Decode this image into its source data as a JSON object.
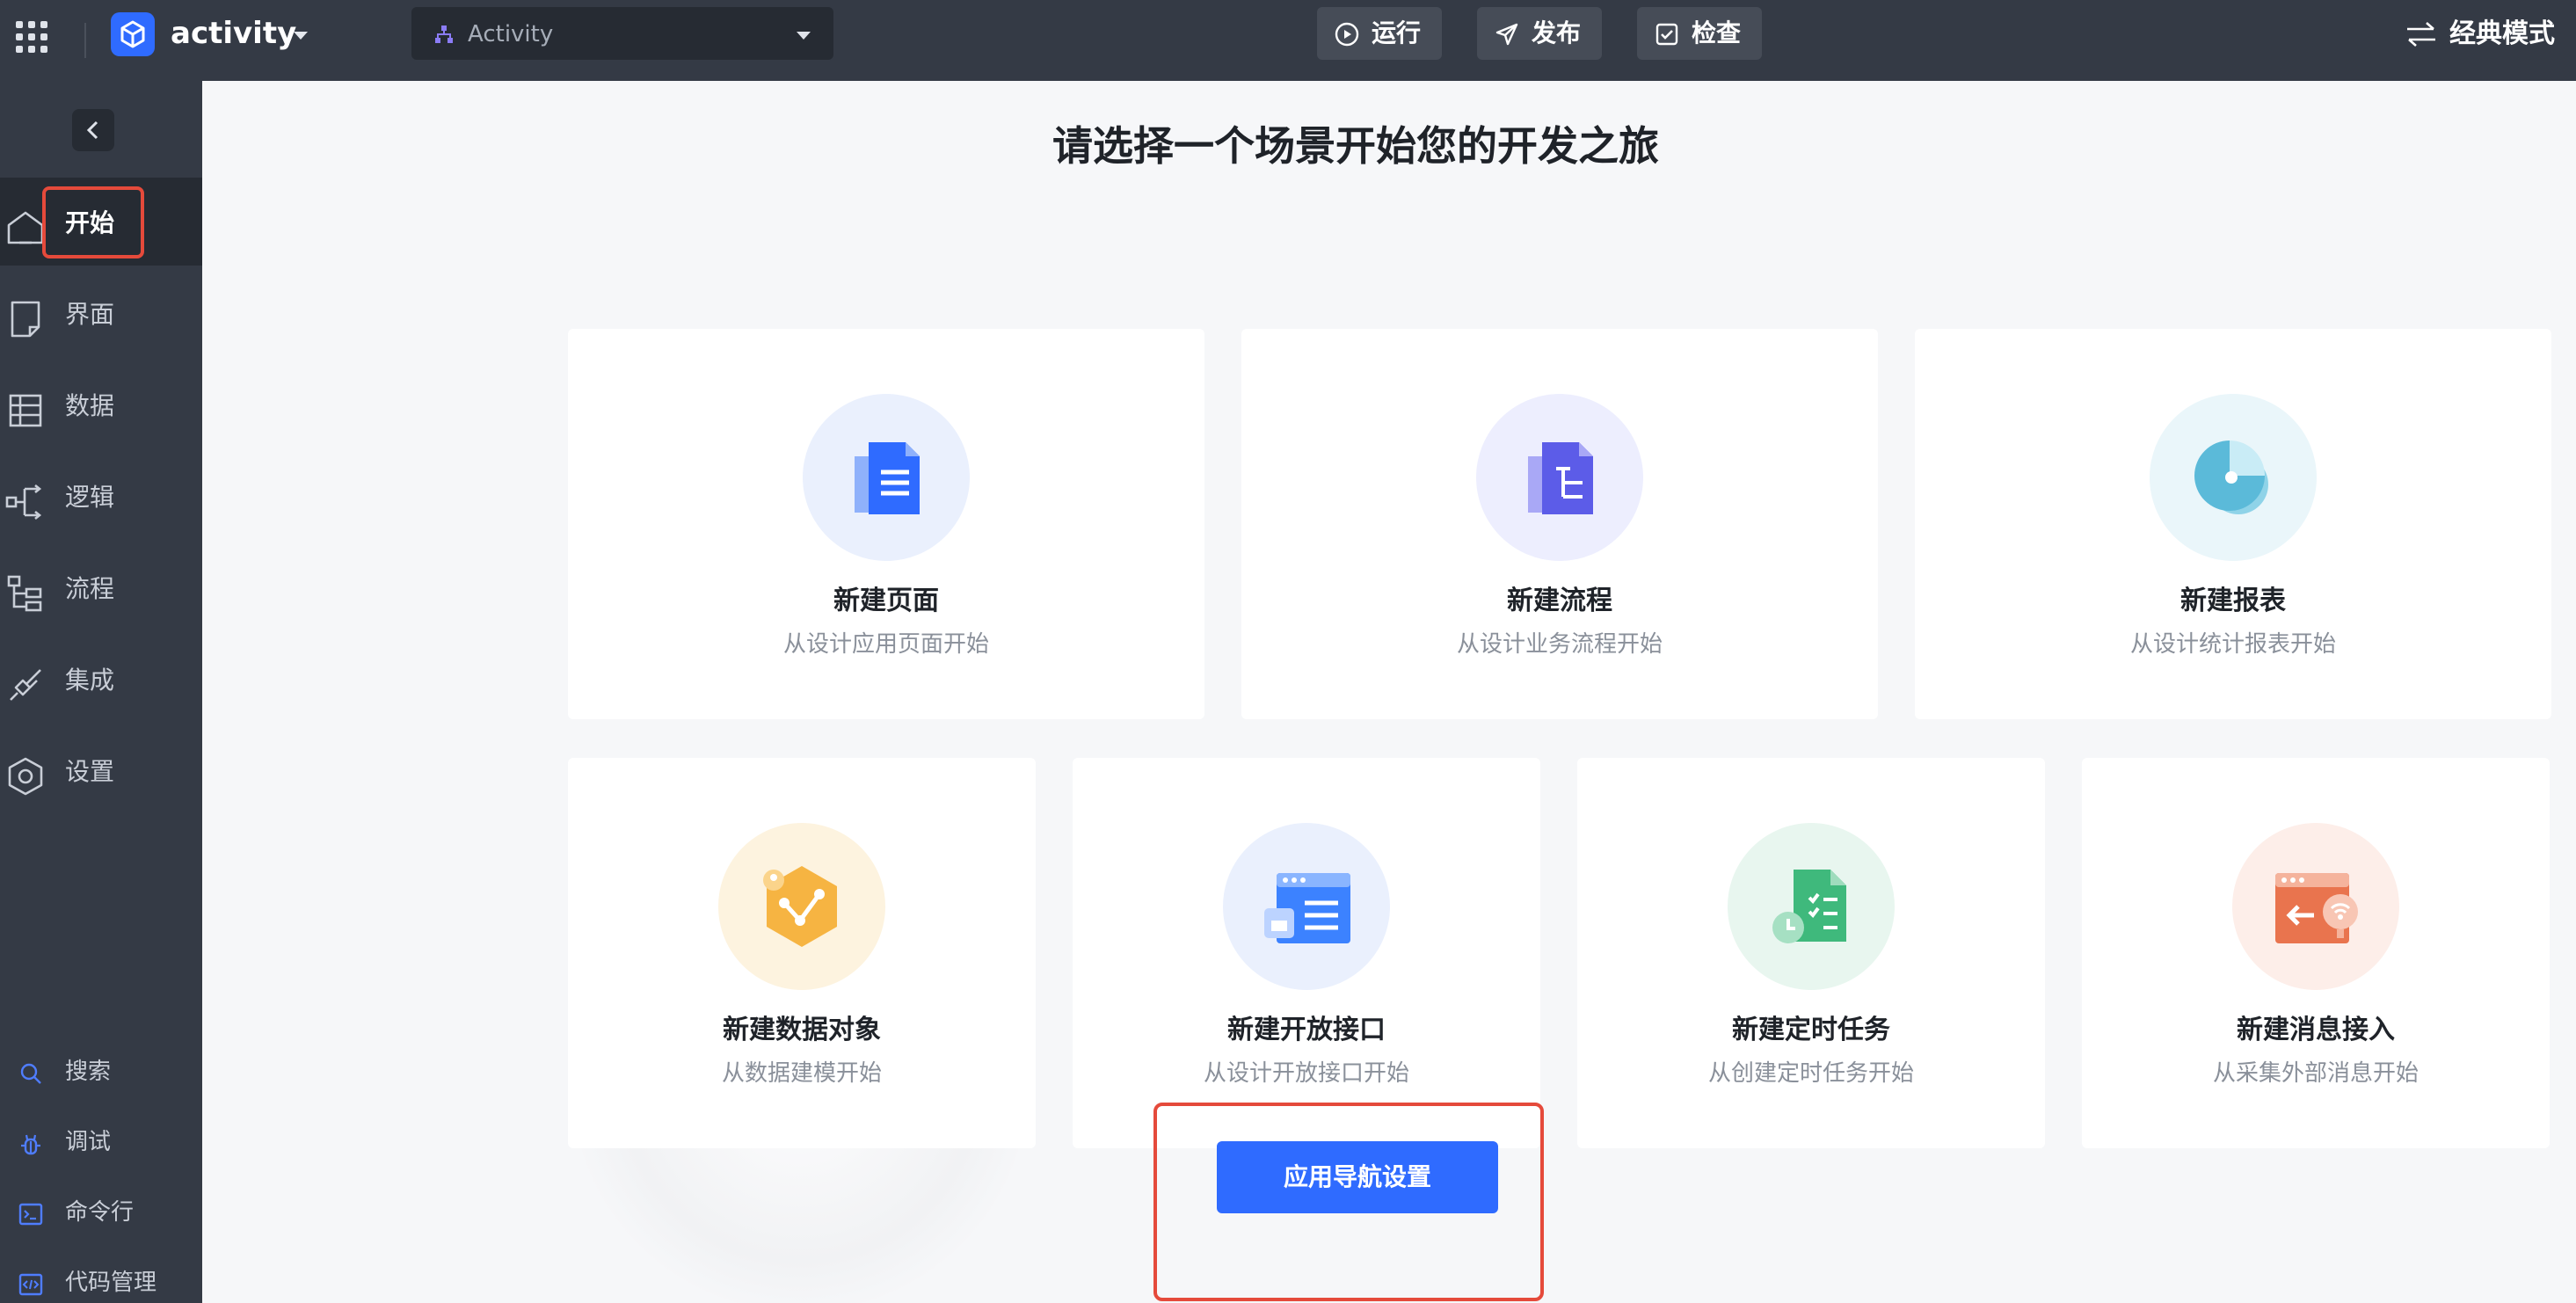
{
  "topbar": {
    "app_name": "activity",
    "page_select": "Activity",
    "run_label": "运行",
    "publish_label": "发布",
    "check_label": "检查",
    "classic_mode_label": "经典模式"
  },
  "sidebar": {
    "nav": [
      {
        "label": "开始",
        "icon": "home-icon",
        "active": true
      },
      {
        "label": "界面",
        "icon": "page-icon"
      },
      {
        "label": "数据",
        "icon": "table-icon"
      },
      {
        "label": "逻辑",
        "icon": "logic-icon"
      },
      {
        "label": "流程",
        "icon": "flow-icon"
      },
      {
        "label": "集成",
        "icon": "plug-icon"
      },
      {
        "label": "设置",
        "icon": "hexagon-settings-icon"
      }
    ],
    "tools": [
      {
        "label": "搜索",
        "icon": "search-icon"
      },
      {
        "label": "调试",
        "icon": "debug-icon"
      },
      {
        "label": "命令行",
        "icon": "terminal-icon"
      },
      {
        "label": "代码管理",
        "icon": "code-icon"
      }
    ]
  },
  "main": {
    "headline": "请选择一个场景开始您的开发之旅",
    "cards": [
      {
        "title": "新建页面",
        "desc": "从设计应用页面开始",
        "icon": "document-icon"
      },
      {
        "title": "新建流程",
        "desc": "从设计业务流程开始",
        "icon": "flow-document-icon"
      },
      {
        "title": "新建报表",
        "desc": "从设计统计报表开始",
        "icon": "pie-chart-icon"
      },
      {
        "title": "新建数据对象",
        "desc": "从数据建模开始",
        "icon": "data-object-icon"
      },
      {
        "title": "新建开放接口",
        "desc": "从设计开放接口开始",
        "icon": "api-icon"
      },
      {
        "title": "新建定时任务",
        "desc": "从创建定时任务开始",
        "icon": "scheduled-task-icon"
      },
      {
        "title": "新建消息接入",
        "desc": "从采集外部消息开始",
        "icon": "message-inbound-icon"
      }
    ],
    "nav_setting_label": "应用导航设置"
  },
  "colors": {
    "accent": "#2f6bff",
    "highlight": "#e54a3b",
    "sidebar_bg": "#343a45"
  }
}
